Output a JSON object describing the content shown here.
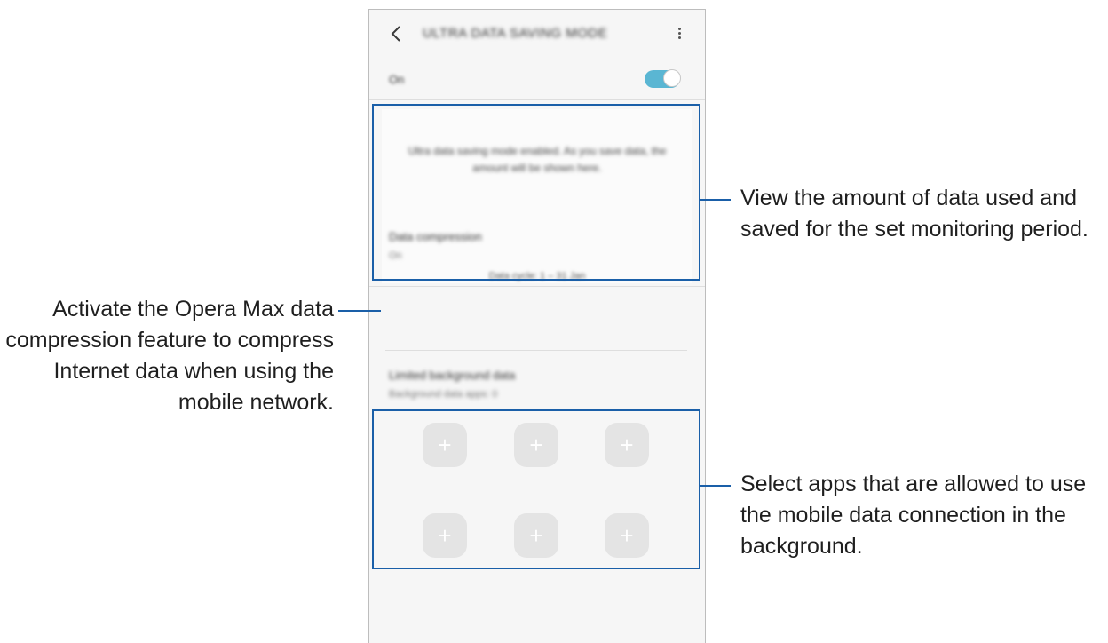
{
  "screen": {
    "title": "ULTRA DATA SAVING MODE",
    "on_label": "On",
    "toggle_on": true,
    "summary_text": "Ultra data saving mode enabled. As you save data, the amount will be shown here.",
    "period_text": "Data cycle: 1 – 31 Jan",
    "settings": [
      {
        "title": "Data compression",
        "subtitle": "On"
      },
      {
        "title": "Limited background data",
        "subtitle": "Background data apps: 0"
      }
    ],
    "add_tile_glyph": "+"
  },
  "callouts": {
    "usage": "View the amount of data used and saved for the set monitoring period.",
    "compression": "Activate the Opera Max data compression feature to compress Internet data when using the mobile network.",
    "apps": "Select apps that are allowed to use the mobile data connection in the background."
  },
  "colors": {
    "highlight": "#1a5fa8",
    "toggle_accent": "#5ab6d3"
  },
  "icons": [
    "back-icon",
    "more-options-icon",
    "plus-icon"
  ]
}
